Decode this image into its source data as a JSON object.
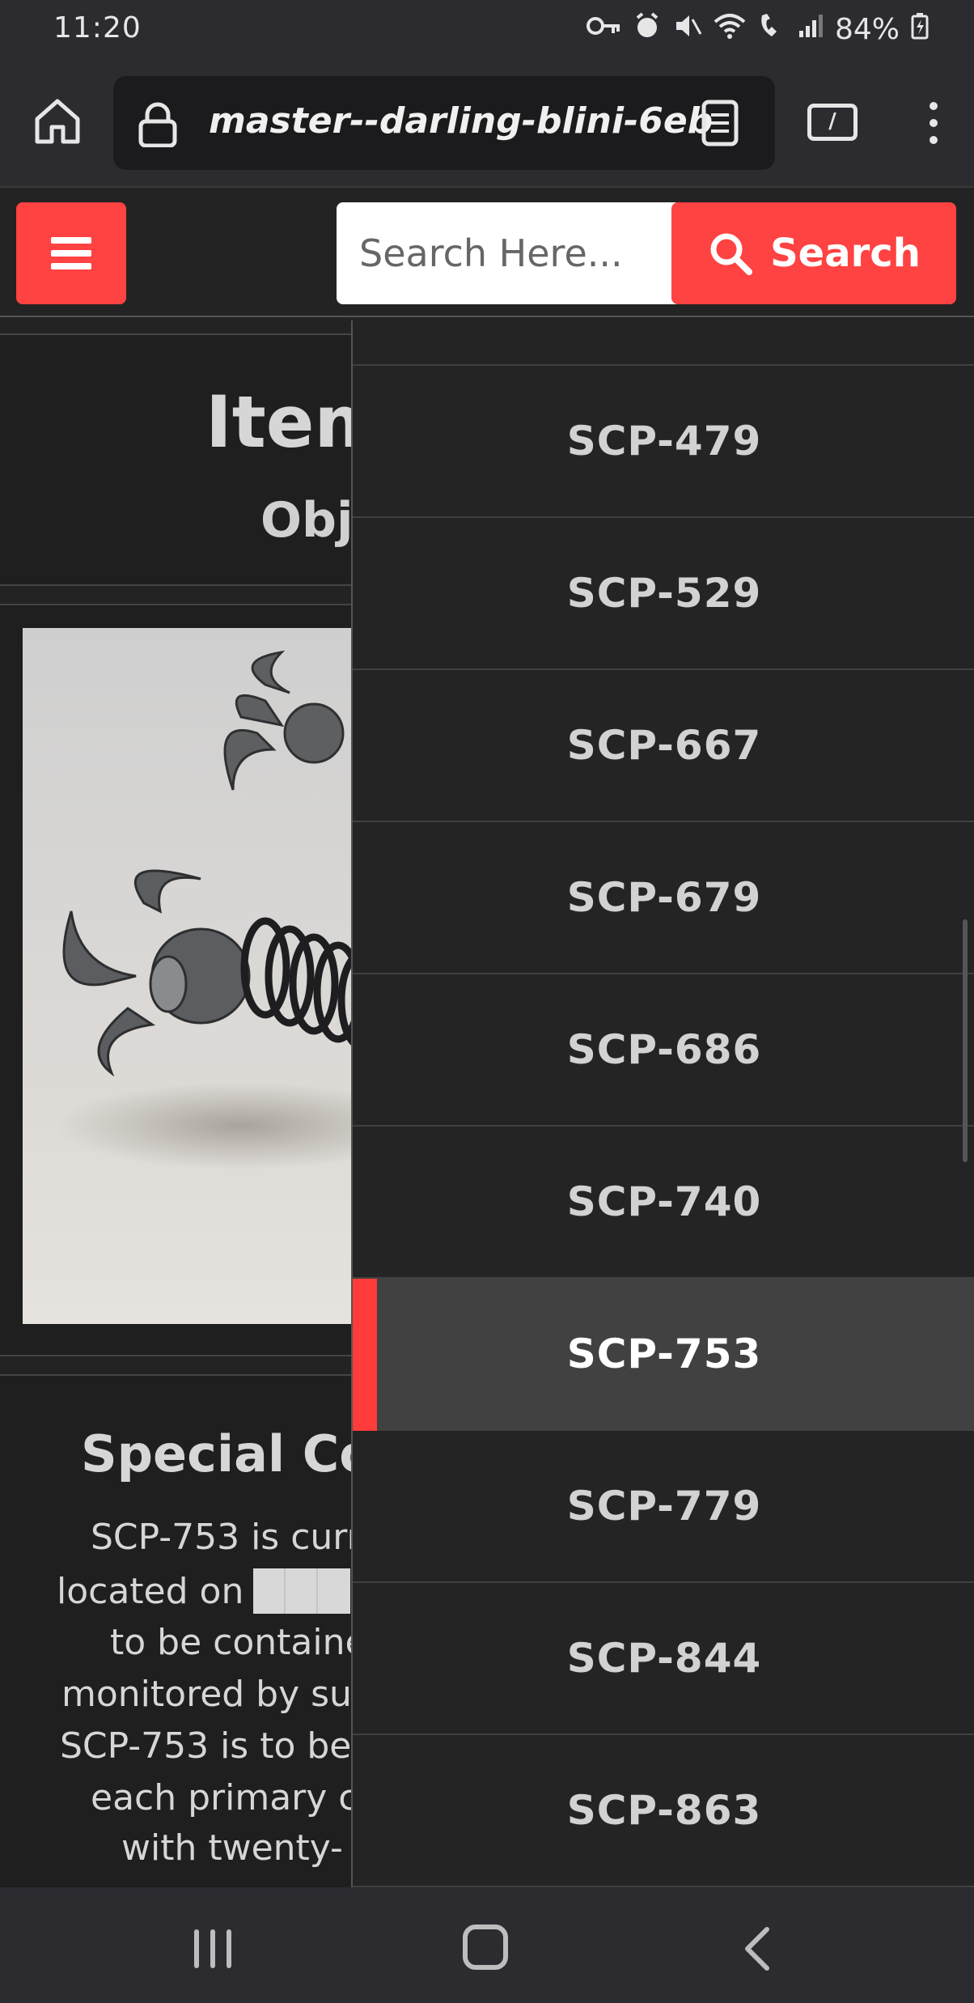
{
  "status_bar": {
    "time": "11:20",
    "battery": "84%",
    "icons": [
      "key-icon",
      "alarm-icon",
      "mute-icon",
      "wifi-icon",
      "wifi-call-icon",
      "signal-icon",
      "battery-icon"
    ]
  },
  "browser": {
    "url": "master--darling-blini-6eb"
  },
  "header": {
    "search_placeholder": "Search Here...",
    "search_button_label": "Search",
    "accent_color": "#ff4242"
  },
  "page": {
    "title_partial": "Item",
    "object_class_partial": "Obj",
    "special_heading_partial": "Special Cor",
    "body_lines_partial": [
      "SCP-753 is curr",
      "located on",
      "to be containe",
      "monitored by su",
      "SCP-753 is to be",
      "each primary c",
      "with twenty-"
    ]
  },
  "sidebar": {
    "items": [
      {
        "label": "SCP-479",
        "active": false
      },
      {
        "label": "SCP-529",
        "active": false
      },
      {
        "label": "SCP-667",
        "active": false
      },
      {
        "label": "SCP-679",
        "active": false
      },
      {
        "label": "SCP-686",
        "active": false
      },
      {
        "label": "SCP-740",
        "active": false
      },
      {
        "label": "SCP-753",
        "active": true
      },
      {
        "label": "SCP-779",
        "active": false
      },
      {
        "label": "SCP-844",
        "active": false
      },
      {
        "label": "SCP-863",
        "active": false
      }
    ]
  }
}
